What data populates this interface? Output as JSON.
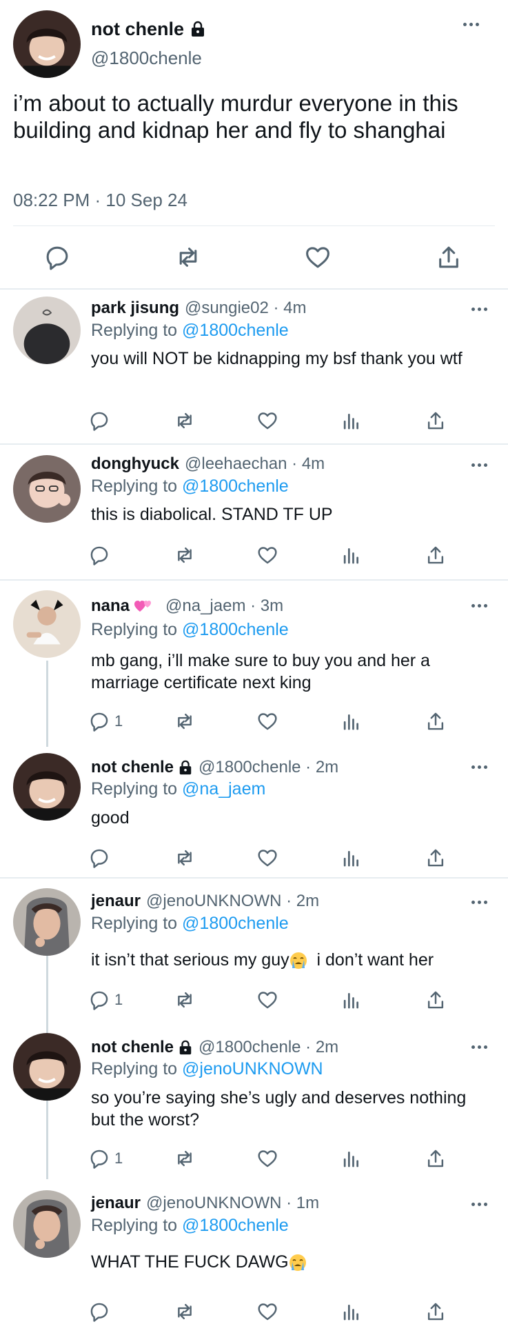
{
  "main": {
    "name": "not chenle",
    "handle": "@1800chenle",
    "text": "i’m about to actually murdur everyone in this building and kidnap her and fly to shanghai",
    "timestamp": "08:22 PM · 10 Sep 24"
  },
  "replies": [
    {
      "name": "park jisung",
      "meta": "@sungie02 · 4m",
      "replying_label": "Replying to",
      "replying_to": "@1800chenle",
      "text": "you will NOT be kidnapping my bsf thank you wtf",
      "reply_count": ""
    },
    {
      "name": "donghyuck",
      "meta": "@leehaechan · 4m",
      "replying_label": "Replying to",
      "replying_to": "@1800chenle",
      "text": "this is diabolical. STAND TF UP",
      "reply_count": ""
    },
    {
      "name": "nana",
      "meta": "@na_jaem · 3m",
      "replying_label": "Replying to",
      "replying_to": "@1800chenle",
      "text": "mb gang, i’ll make sure to buy you and her a marriage certificate next king",
      "reply_count": "1"
    },
    {
      "name": "not chenle",
      "meta": "@1800chenle · 2m",
      "replying_label": "Replying to",
      "replying_to": "@na_jaem",
      "text": "good",
      "reply_count": ""
    },
    {
      "name": "jenaur",
      "meta": "@jenoUNKNOWN · 2m",
      "replying_label": "Replying to",
      "replying_to": "@1800chenle",
      "text_a": "it isn’t that serious my guy",
      "text_b": "  i don’t want her",
      "reply_count": "1"
    },
    {
      "name": "not chenle",
      "meta": "@1800chenle · 2m",
      "replying_label": "Replying to",
      "replying_to": "@jenoUNKNOWN",
      "text": "so you’re saying she’s ugly and deserves nothing but the worst?",
      "reply_count": "1"
    },
    {
      "name": "jenaur",
      "meta": "@jenoUNKNOWN · 1m",
      "replying_label": "Replying to",
      "replying_to": "@1800chenle",
      "text": "WHAT THE FUCK DAWG",
      "reply_count": ""
    }
  ],
  "icons": {
    "reply": "reply-icon",
    "retweet": "retweet-icon",
    "like": "heart-icon",
    "views": "views-icon",
    "share": "share-icon",
    "more": "more-icon",
    "lock": "lock-icon",
    "emoji_crying": "crying-emoji-icon",
    "emoji_hearts": "hearts-emoji-icon"
  },
  "colors": {
    "text": "#0f1419",
    "secondary": "#536471",
    "link": "#1d9bf0",
    "divider": "#e6ecf0"
  }
}
